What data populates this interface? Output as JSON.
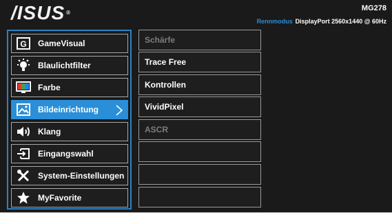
{
  "header": {
    "brand": "/ISUS",
    "brand_mark": "®",
    "model": "MG278",
    "mode": "Rennmodus",
    "signal": "DisplayPort 2560x1440 @ 60Hz"
  },
  "main_menu": {
    "items": [
      {
        "label": "GameVisual",
        "icon": "gamevisual-icon",
        "selected": false
      },
      {
        "label": "Blaulichtfilter",
        "icon": "bluelight-bulb-icon",
        "selected": false
      },
      {
        "label": "Farbe",
        "icon": "color-monitor-icon",
        "selected": false
      },
      {
        "label": "Bildeinrichtung",
        "icon": "image-icon",
        "selected": true
      },
      {
        "label": "Klang",
        "icon": "speaker-icon",
        "selected": false
      },
      {
        "label": "Eingangswahl",
        "icon": "input-select-icon",
        "selected": false
      },
      {
        "label": "System-Einstellungen",
        "icon": "tools-icon",
        "selected": false
      },
      {
        "label": "MyFavorite",
        "icon": "star-icon",
        "selected": false
      }
    ]
  },
  "sub_menu": {
    "items": [
      {
        "label": "Schärfe",
        "enabled": false
      },
      {
        "label": "Trace Free",
        "enabled": true
      },
      {
        "label": "Kontrollen",
        "enabled": true
      },
      {
        "label": "VividPixel",
        "enabled": true
      },
      {
        "label": "ASCR",
        "enabled": false
      },
      {
        "label": "",
        "enabled": false
      },
      {
        "label": "",
        "enabled": false
      },
      {
        "label": "",
        "enabled": false
      }
    ]
  },
  "colors": {
    "accent": "#2a8fd8",
    "mode_text": "#2b8fd6",
    "background": "#1a1a1a"
  }
}
